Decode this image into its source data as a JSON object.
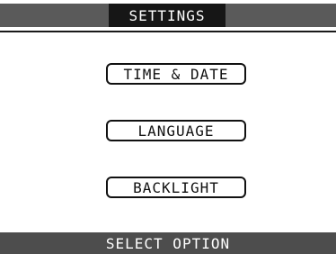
{
  "header": {
    "title": "SETTINGS"
  },
  "menu": {
    "options": [
      {
        "label": "TIME & DATE"
      },
      {
        "label": "LANGUAGE"
      },
      {
        "label": "BACKLIGHT"
      }
    ]
  },
  "footer": {
    "status": "SELECT OPTION"
  },
  "colors": {
    "top_band": "#5a5a5a",
    "title_box": "#161616",
    "bottom_band": "#4d4d4d",
    "border": "#111111",
    "background": "#ffffff"
  }
}
